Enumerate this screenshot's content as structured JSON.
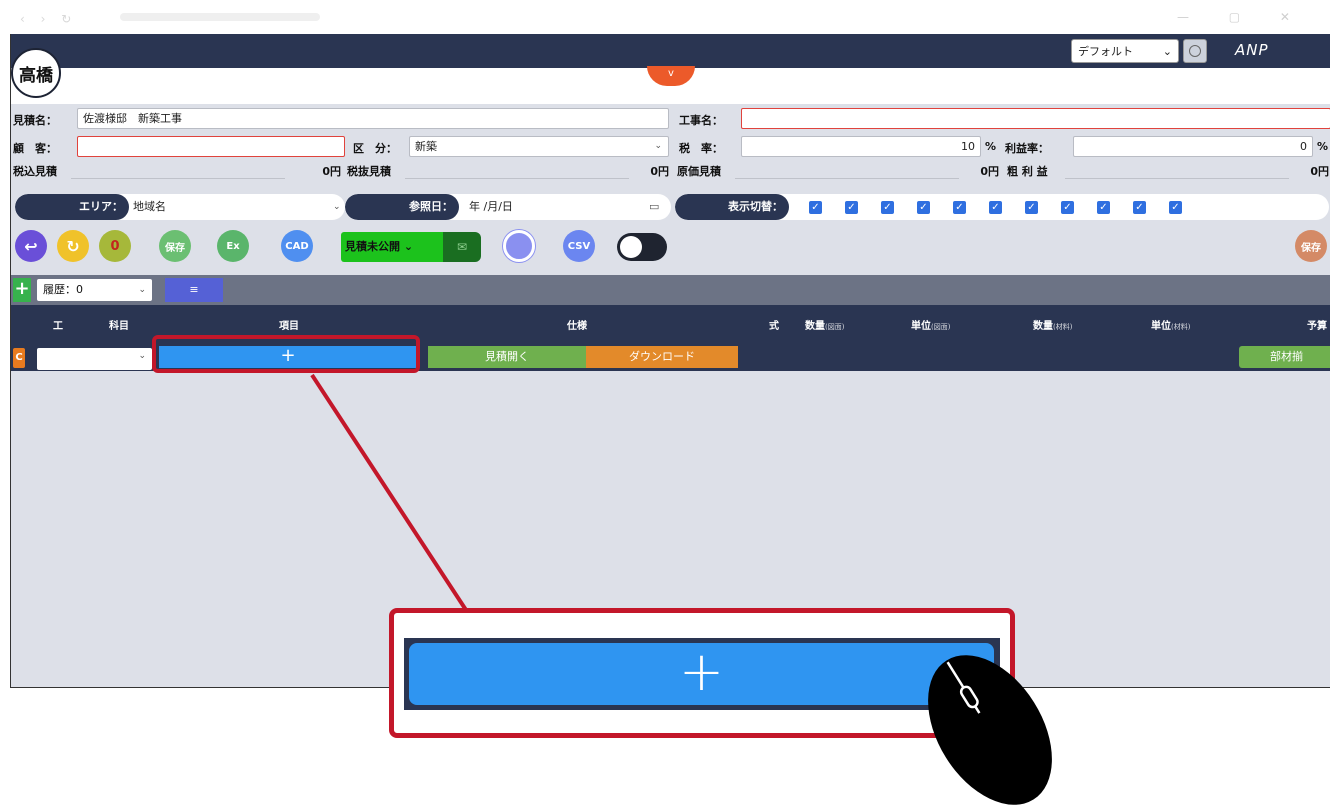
{
  "header": {
    "user_initial": "高橋",
    "collapse_icon": "v",
    "preset_select": "デフォルト",
    "logo_text": "ANP"
  },
  "estimate": {
    "name_label": "見積名：",
    "name_value": "佐渡様邸　新築工事",
    "project_label": "工事名：",
    "project_value": "",
    "customer_label": "顧　客：",
    "customer_value": "",
    "category_label": "区　分：",
    "category_value": "新築",
    "tax_label": "税　率：",
    "tax_value": "10",
    "tax_unit": "%",
    "profit_label": "利益率：",
    "profit_value": "0",
    "profit_unit": "%"
  },
  "summary": {
    "incl_tax_label": "税込見積",
    "incl_tax_value": "0円",
    "excl_tax_label": "税抜見積",
    "excl_tax_value": "0円",
    "cost_label": "原価見積",
    "cost_value": "0円",
    "gross_label": "粗 利 益",
    "gross_value": "0円"
  },
  "filters": {
    "area_tag": "エリア：",
    "area_value": "地域名",
    "refdate_tag": "参照日：",
    "refdate_value": "年 /月/日",
    "display_tag": "表示切替：",
    "checkbox_count": 11
  },
  "actions": {
    "back": "↩",
    "reload": "↻",
    "zero": "0",
    "save": "保存",
    "excel": "Ex",
    "cad": "CAD",
    "status": "見積未公開",
    "csv": "CSV",
    "save_right": "保存"
  },
  "toolbar": {
    "add": "+",
    "history": "履歴：0",
    "menu": "≡"
  },
  "table": {
    "headers": [
      "工",
      "科目",
      "項目",
      "仕様",
      "式",
      "数量",
      "単位",
      "数量",
      "単位",
      "予算"
    ],
    "header_subs": [
      "",
      "",
      "",
      "",
      "",
      "(図面)",
      "(図面)",
      "(材料)",
      "(材料)",
      ""
    ],
    "row": {
      "badge": "C",
      "add": "+",
      "open": "見積開く",
      "download": "ダウンロード",
      "parts": "部材揃"
    }
  },
  "zoom": {
    "add": "+"
  },
  "colors": {
    "header_bg": "#2a3552",
    "accent_blue": "#2f95f1",
    "annotation_red": "#c3172a"
  }
}
